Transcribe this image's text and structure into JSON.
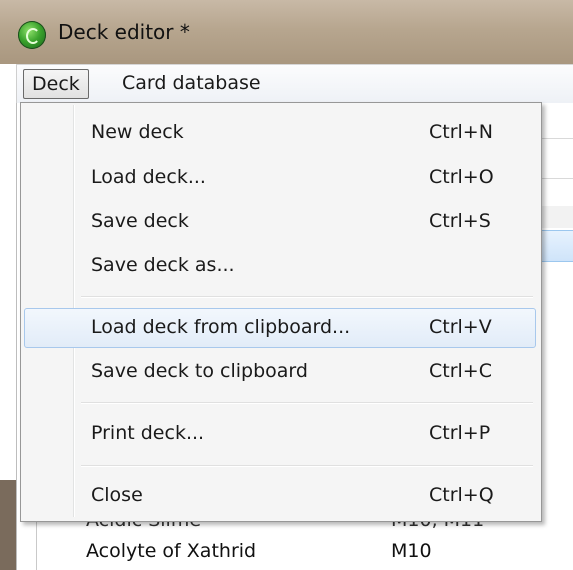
{
  "window": {
    "title": "Deck editor *"
  },
  "menubar": {
    "items": [
      "Deck",
      "Card database"
    ]
  },
  "deck_menu": {
    "groups": [
      [
        {
          "label": "New deck",
          "shortcut": "Ctrl+N"
        },
        {
          "label": "Load deck...",
          "shortcut": "Ctrl+O"
        },
        {
          "label": "Save deck",
          "shortcut": "Ctrl+S"
        },
        {
          "label": "Save deck as...",
          "shortcut": ""
        }
      ],
      [
        {
          "label": "Load deck from clipboard...",
          "shortcut": "Ctrl+V",
          "highlighted": true
        },
        {
          "label": "Save deck to clipboard",
          "shortcut": "Ctrl+C"
        }
      ],
      [
        {
          "label": "Print deck...",
          "shortcut": "Ctrl+P"
        }
      ],
      [
        {
          "label": "Close",
          "shortcut": "Ctrl+Q"
        }
      ]
    ]
  },
  "card_list": {
    "rows": [
      {
        "name": "Acidic Slime",
        "set": "M10, M11"
      },
      {
        "name": "Acolyte of Xathrid",
        "set": "M10"
      }
    ]
  }
}
